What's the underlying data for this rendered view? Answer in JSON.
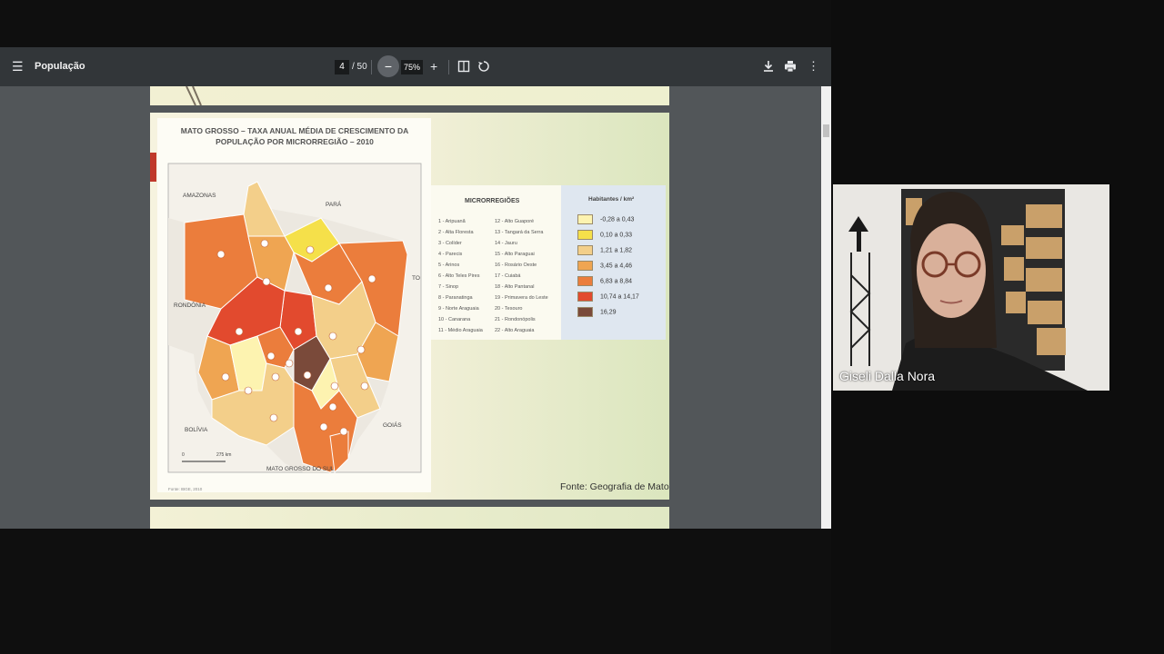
{
  "viewer": {
    "doc_title": "População",
    "current_page": "4",
    "total_pages": "/ 50",
    "zoom": "75%",
    "icons": [
      "menu-icon",
      "zoom-out-icon",
      "zoom-in-icon",
      "fit-page-icon",
      "rotate-icon",
      "download-icon",
      "print-icon",
      "more-vert-icon"
    ]
  },
  "slide": {
    "map_title_line1": "MATO GROSSO – TAXA ANUAL MÉDIA DE CRESCIMENTO DA",
    "map_title_line2": "POPULAÇÃO POR MICRORREGIÃO – 2010",
    "neighbors": {
      "amazonas": "AMAZONAS",
      "para": "PARÁ",
      "to": "TO",
      "rondonia": "RONDÔNIA",
      "bolivia": "BOLÍVIA",
      "goias": "GOIÁS",
      "ms": "MATO GROSSO DO SUL"
    },
    "scale": {
      "zero": "0",
      "km": "275 km"
    },
    "map_source": "Fonte: IBGE, 2010",
    "legend_title": "MICRORREGIÕES",
    "microregions": [
      "1 - Aripuanã",
      "2 - Alta Floresta",
      "3 - Colíder",
      "4 - Parecis",
      "5 - Arinos",
      "6 - Alto Teles Pires",
      "7 - Sinop",
      "8 - Paranatinga",
      "9 - Norte Araguaia",
      "10 - Canarana",
      "11 - Médio Araguaia",
      "12 - Alto Guaporé",
      "13 - Tangará da Serra",
      "14 - Jauru",
      "15 - Alto Paraguai",
      "16 - Rosário Oeste",
      "17 - Cuiabá",
      "18 - Alto Pantanal",
      "19 - Primavera do Leste",
      "20 - Tesouro",
      "21 - Rondonópolis",
      "22 - Alto Araguaia"
    ],
    "density_title": "Habitantes / km²",
    "density_classes": [
      {
        "label": "-0,28  a  0,43",
        "color": "#fdf3b0"
      },
      {
        "label": "0,10  a  0,33",
        "color": "#f5e04a"
      },
      {
        "label": "1,21  a  1,82",
        "color": "#f3cf8a"
      },
      {
        "label": "3,45  a  4,46",
        "color": "#efa552"
      },
      {
        "label": "6,83  a  8,84",
        "color": "#eb7d3c"
      },
      {
        "label": "10,74  a  14,17",
        "color": "#e24a2e"
      },
      {
        "label": "16,29",
        "color": "#7a4a3a"
      }
    ],
    "source": "Fonte: Geografia de Mato"
  },
  "webcam": {
    "participant_name": "Giseli Dalla Nora"
  }
}
